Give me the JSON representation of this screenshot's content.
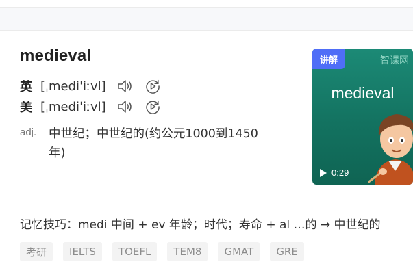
{
  "word": "medieval",
  "pronunciations": [
    {
      "label": "英",
      "phonetic": "[ˌmediˈiːvl]"
    },
    {
      "label": "美",
      "phonetic": "[ˌmediˈiːvl]"
    }
  ],
  "definition": {
    "pos": "adj.",
    "meaning": "中世纪；中世纪的(约公元1000到1450年)"
  },
  "video": {
    "badge": "讲解",
    "brand": "智课网",
    "title": "medieval",
    "duration": "0:29"
  },
  "memory_tip": "记忆技巧：medi 中间 + ev 年龄；时代；寿命 + al …的 → 中世纪的",
  "tags": [
    "考研",
    "IELTS",
    "TOEFL",
    "TEM8",
    "GMAT",
    "GRE"
  ],
  "colors": {
    "badge": "#4f6ef7",
    "video_bg": "#137260",
    "tag_bg": "#f3f3f3"
  }
}
